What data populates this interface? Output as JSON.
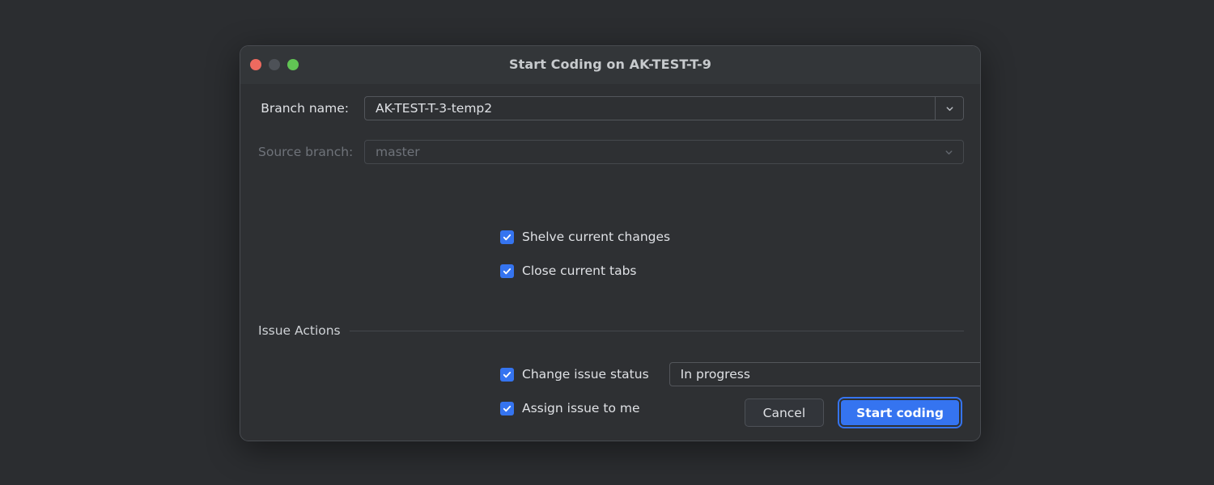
{
  "window": {
    "title": "Start Coding on AK-TEST-T-9",
    "traffic_lights": [
      {
        "name": "close",
        "color": "#ee6a5f"
      },
      {
        "name": "minimize",
        "color": "#4d5157"
      },
      {
        "name": "zoom",
        "color": "#61c454"
      }
    ]
  },
  "form": {
    "branch_name": {
      "label": "Branch name:",
      "value": "AK-TEST-T-3-temp2",
      "dropdown_icon": "chevron-down-icon",
      "enabled": true
    },
    "source_branch": {
      "label": "Source branch:",
      "value": "master",
      "dropdown_icon": "chevron-down-icon",
      "enabled": false
    },
    "checkboxes": [
      {
        "label": "Shelve current changes",
        "checked": true
      },
      {
        "label": "Close current tabs",
        "checked": true
      }
    ]
  },
  "issue_actions": {
    "group_title": "Issue Actions",
    "change_status": {
      "label": "Change issue status",
      "checked": true,
      "value": "In progress",
      "dropdown_icon": "chevron-down-icon"
    },
    "assign_to_me": {
      "label": "Assign issue to me",
      "checked": true
    }
  },
  "footer": {
    "cancel_label": "Cancel",
    "confirm_label": "Start coding"
  },
  "colors": {
    "accent": "#3574f0",
    "dialog_bg": "#2e3033",
    "page_bg": "#2b2d30",
    "text": "#dfe1e5",
    "text_disabled": "#6f737a"
  }
}
